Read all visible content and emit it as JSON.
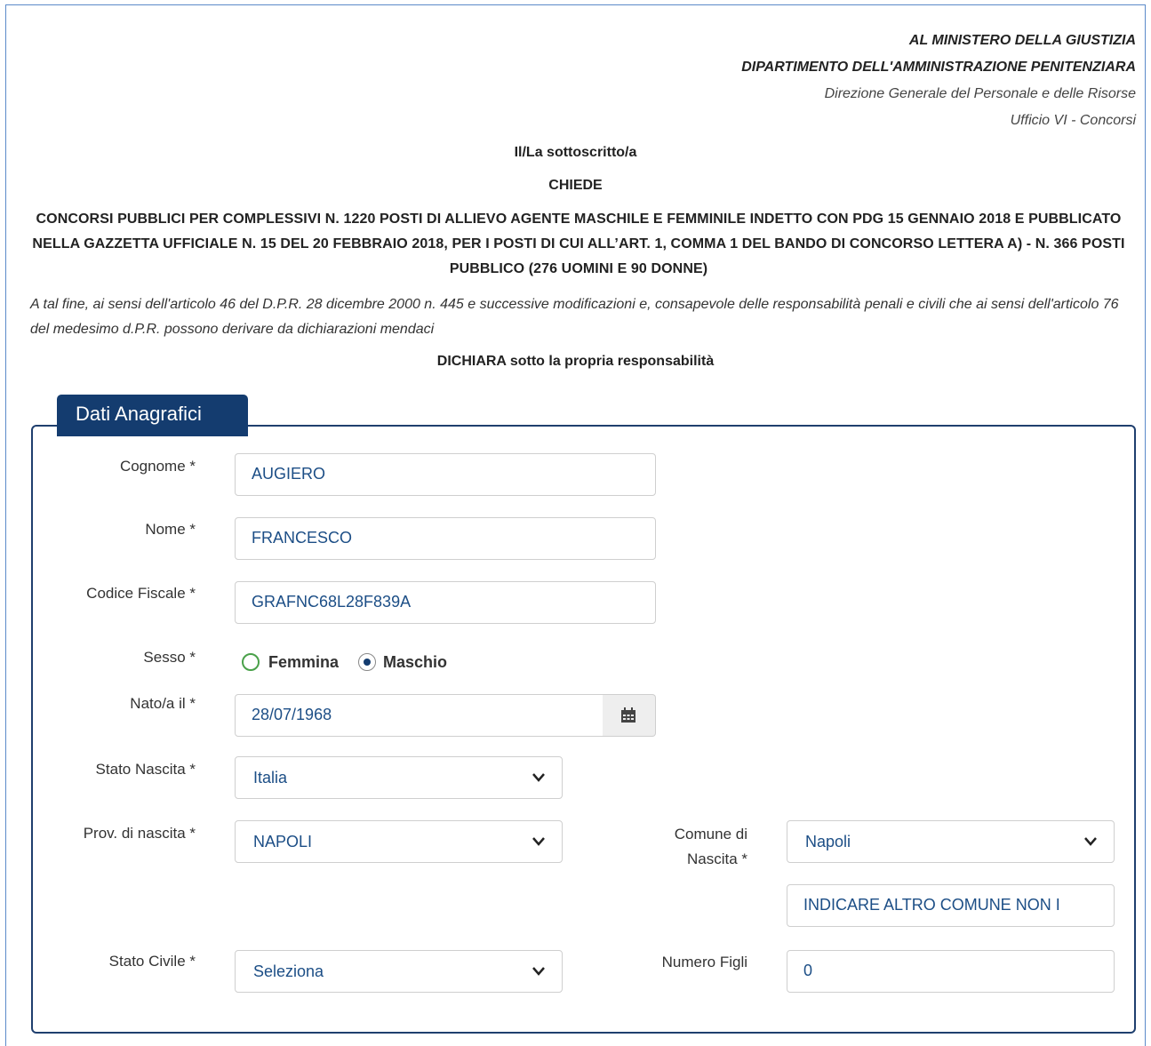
{
  "header": {
    "line1": "AL MINISTERO DELLA GIUSTIZIA",
    "line2": "DIPARTIMENTO DELL'AMMINISTRAZIONE PENITENZIARA",
    "line3": "Direzione Generale del Personale e delle Risorse",
    "line4": "Ufficio VI - Concorsi"
  },
  "intro": {
    "sottoscritto": "Il/La sottoscritto/a",
    "chiede": "CHIEDE",
    "concorso": "CONCORSI PUBBLICI PER COMPLESSIVI N. 1220 POSTI DI ALLIEVO AGENTE MASCHILE E FEMMINILE INDETTO CON PDG 15 GENNAIO 2018 E PUBBLICATO NELLA GAZZETTA UFFICIALE N. 15 DEL 20 FEBBRAIO 2018, PER I POSTI DI CUI ALL’ART. 1, COMMA 1 DEL BANDO DI CONCORSO LETTERA A) - N. 366 POSTI PUBBLICO (276 UOMINI E 90 DONNE)",
    "declaration_text": "A tal fine, ai sensi dell'articolo 46 del D.P.R. 28 dicembre 2000 n. 445 e successive modificazioni e, consapevole delle responsabilità penali e civili che ai sensi dell'articolo 76 del medesimo d.P.R. possono derivare da dichiarazioni mendaci",
    "dichiara": "DICHIARA sotto la propria responsabilità"
  },
  "form": {
    "legend": "Dati Anagrafici",
    "cognome": {
      "label": "Cognome *",
      "value": "AUGIERO"
    },
    "nome": {
      "label": "Nome *",
      "value": "FRANCESCO"
    },
    "codice_fiscale": {
      "label": "Codice Fiscale *",
      "value": "GRAFNC68L28F839A"
    },
    "sesso": {
      "label": "Sesso *",
      "option_f": "Femmina",
      "option_m": "Maschio",
      "selected": "Maschio"
    },
    "nato_il": {
      "label": "Nato/a il *",
      "value": "28/07/1968",
      "icon": "calendar-icon"
    },
    "stato_nascita": {
      "label": "Stato Nascita *",
      "value": "Italia"
    },
    "prov_nascita": {
      "label": "Prov. di nascita *",
      "value": "NAPOLI"
    },
    "comune_nascita": {
      "label_line1": "Comune di",
      "label_line2": "Nascita *",
      "value": "Napoli",
      "altro_value": "INDICARE ALTRO COMUNE NON I"
    },
    "stato_civile": {
      "label": "Stato Civile *",
      "value": "Seleziona"
    },
    "numero_figli": {
      "label": "Numero Figli",
      "value": "0"
    }
  },
  "colors": {
    "accent": "#143c6f",
    "value_text": "#1c4e86",
    "radio_border": "#4aa14a"
  }
}
